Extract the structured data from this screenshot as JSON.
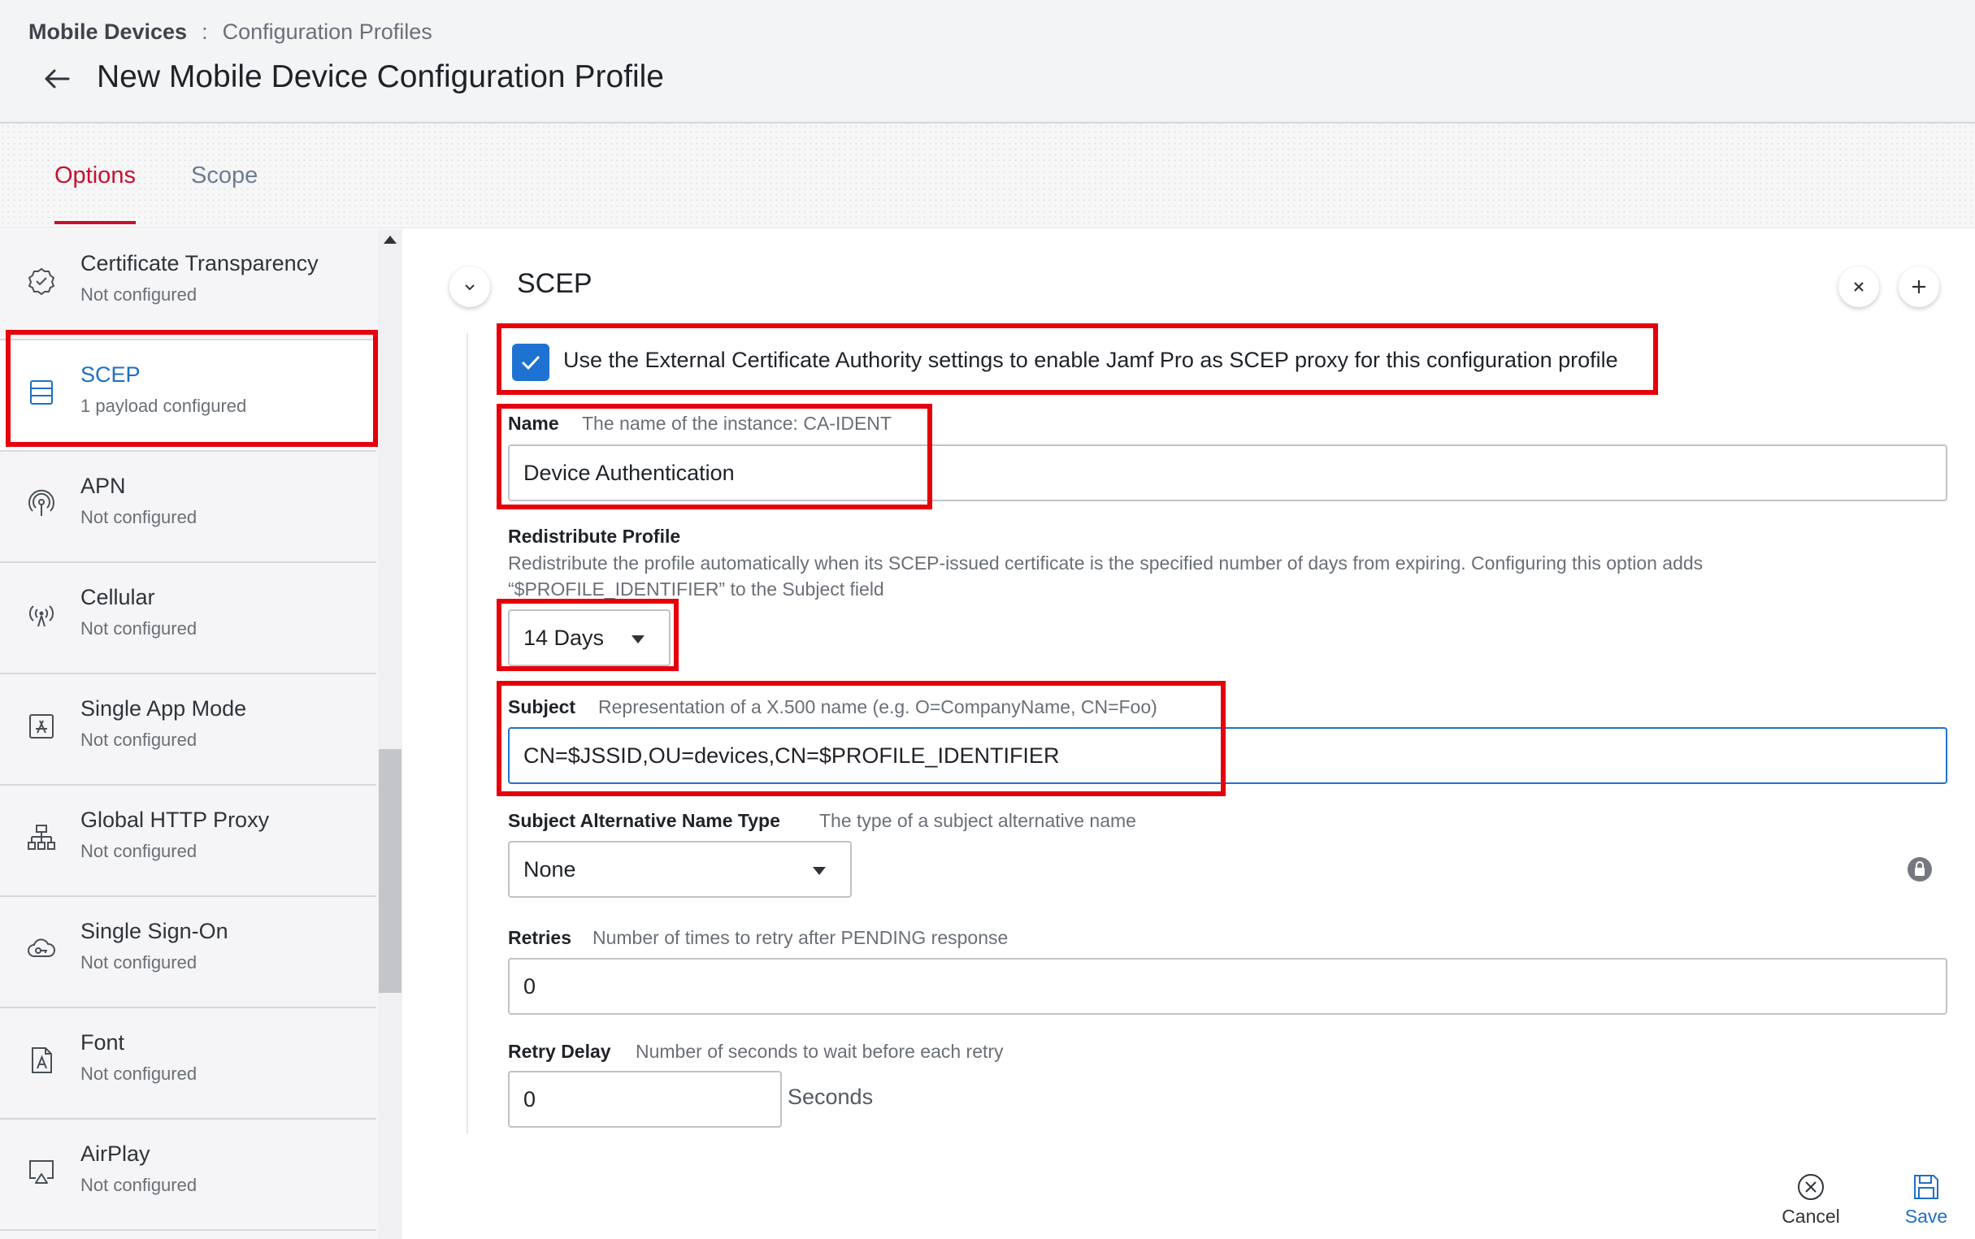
{
  "breadcrumb": {
    "root": "Mobile Devices",
    "separator": ":",
    "current": "Configuration Profiles"
  },
  "page": {
    "title": "New Mobile Device Configuration Profile"
  },
  "tabs": [
    {
      "label": "Options",
      "active": true
    },
    {
      "label": "Scope",
      "active": false
    }
  ],
  "sidebar": {
    "items": [
      {
        "title": "Certificate Transparency",
        "subtitle": "Not configured",
        "icon": "certificate-badge-icon"
      },
      {
        "title": "SCEP",
        "subtitle": "1 payload configured",
        "icon": "scep-server-icon",
        "selected": true
      },
      {
        "title": "APN",
        "subtitle": "Not configured",
        "icon": "antenna-icon"
      },
      {
        "title": "Cellular",
        "subtitle": "Not configured",
        "icon": "cellular-signal-icon"
      },
      {
        "title": "Single App Mode",
        "subtitle": "Not configured",
        "icon": "app-store-icon"
      },
      {
        "title": "Global HTTP Proxy",
        "subtitle": "Not configured",
        "icon": "network-proxy-icon"
      },
      {
        "title": "Single Sign-On",
        "subtitle": "Not configured",
        "icon": "cloud-key-icon"
      },
      {
        "title": "Font",
        "subtitle": "Not configured",
        "icon": "font-file-icon"
      },
      {
        "title": "AirPlay",
        "subtitle": "Not configured",
        "icon": "airplay-icon"
      }
    ]
  },
  "section": {
    "title": "SCEP",
    "collapse_icon": "chevron-down-icon",
    "remove_icon": "close-icon",
    "add_icon": "plus-icon"
  },
  "form": {
    "external_ca": {
      "label": "Use the External Certificate Authority settings to enable Jamf Pro as SCEP proxy for this configuration profile",
      "checked": true
    },
    "name": {
      "label": "Name",
      "hint": "The name of the instance: CA-IDENT",
      "value": "Device Authentication"
    },
    "redistribute": {
      "label": "Redistribute Profile",
      "description": "Redistribute the profile automatically when its SCEP-issued certificate is the specified number of days from expiring. Configuring this option adds “$PROFILE_IDENTIFIER” to the Subject field",
      "value": "14 Days"
    },
    "subject": {
      "label": "Subject",
      "hint": "Representation of a X.500 name (e.g. O=CompanyName, CN=Foo)",
      "value": "CN=$JSSID,OU=devices,CN=$PROFILE_IDENTIFIER"
    },
    "san_type": {
      "label": "Subject Alternative Name Type",
      "hint": "The type of a subject alternative name",
      "value": "None"
    },
    "retries": {
      "label": "Retries",
      "hint": "Number of times to retry after PENDING response",
      "value": "0"
    },
    "retry_delay": {
      "label": "Retry Delay",
      "hint": "Number of seconds to wait before each retry",
      "value": "0",
      "suffix": "Seconds"
    }
  },
  "footer": {
    "cancel_label": "Cancel",
    "save_label": "Save"
  },
  "colors": {
    "accent": "#c8102e",
    "primary": "#1f72d1",
    "annotation": "#e5000b"
  }
}
